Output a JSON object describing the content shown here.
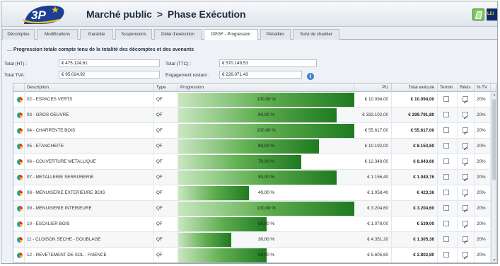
{
  "header": {
    "logo_text": "3P",
    "crumb_root": "Marché public",
    "crumb_sep": ">",
    "crumb_page": "Phase Exécution",
    "user_badge": "LEI"
  },
  "tabs": [
    {
      "label": "Décomptes",
      "active": false
    },
    {
      "label": "Modifications",
      "active": false
    },
    {
      "label": "Garantie",
      "active": false
    },
    {
      "label": "Suspensions",
      "active": false
    },
    {
      "label": "Délai d'exécution",
      "active": false
    },
    {
      "label": "DPGF - Progression",
      "active": true
    },
    {
      "label": "Pénalités",
      "active": false
    },
    {
      "label": "Suivi de chantier",
      "active": false
    }
  ],
  "summary": {
    "title": "Progression totale compte tenu de la totalité des décomptes et des avenants",
    "total_ht_label": "Total (HT) :",
    "total_ht_value": "€ 475.124,61",
    "total_ttc_label": "Total (TTC) :",
    "total_ttc_value": "€ 570.149,53",
    "total_tva_label": "Total TVA :",
    "total_tva_value": "€ 95.024,92",
    "engagement_label": "Engagement restant :",
    "engagement_value": "€ 226.071,43",
    "info_glyph": "i"
  },
  "grid": {
    "columns": {
      "description": "Description",
      "type": "Type",
      "progression": "Progression",
      "pu": "PU",
      "total": "Total exécuté",
      "termin": "Termin",
      "revis": "Révis",
      "tva": "% TV"
    },
    "rows": [
      {
        "description": "02 - ESPACES VERTS",
        "type": "QF",
        "progress": 100,
        "progress_label": "100,00 %",
        "pu": "€ 10.094,00",
        "total": "€ 10.094,00",
        "termine": false,
        "revis": true,
        "tva": "20%"
      },
      {
        "description": "03 - GROS OEUVRE",
        "type": "QF",
        "progress": 90,
        "progress_label": "90,00 %",
        "pu": "€ 333.102,00",
        "total": "€ 299.791,80",
        "termine": false,
        "revis": true,
        "tva": "20%"
      },
      {
        "description": "04 - CHARPENTE BOIS",
        "type": "QF",
        "progress": 100,
        "progress_label": "100,00 %",
        "pu": "€ 55.617,00",
        "total": "€ 55.617,00",
        "termine": false,
        "revis": true,
        "tva": "20%"
      },
      {
        "description": "05 - ETANCHEITE",
        "type": "QF",
        "progress": 80,
        "progress_label": "80,00 %",
        "pu": "€ 10.192,00",
        "total": "€ 8.153,60",
        "termine": false,
        "revis": true,
        "tva": "20%"
      },
      {
        "description": "06 - COUVERTURE METALLIQUE",
        "type": "QF",
        "progress": 70,
        "progress_label": "70,00 %",
        "pu": "€ 12.348,00",
        "total": "€ 8.643,60",
        "termine": false,
        "revis": true,
        "tva": "20%"
      },
      {
        "description": "07 - METALLERIE SERRURERIE",
        "type": "QF",
        "progress": 90,
        "progress_label": "90,00 %",
        "pu": "€ 1.156,40",
        "total": "€ 1.040,76",
        "termine": false,
        "revis": true,
        "tva": "20%"
      },
      {
        "description": "08 - MENUISERIE EXTERIEURE BOIS",
        "type": "QF",
        "progress": 40,
        "progress_label": "40,00 %",
        "pu": "€ 1.058,40",
        "total": "€ 423,36",
        "termine": false,
        "revis": true,
        "tva": "20%"
      },
      {
        "description": "09 - MENUISERIE INTERIEURE",
        "type": "QF",
        "progress": 100,
        "progress_label": "100,00 %",
        "pu": "€ 3.204,60",
        "total": "€ 3.204,60",
        "termine": false,
        "revis": true,
        "tva": "20%"
      },
      {
        "description": "10 - ESCALIER BOIS",
        "type": "QF",
        "progress": 50,
        "progress_label": "50,00 %",
        "pu": "€ 1.078,00",
        "total": "€ 539,00",
        "termine": false,
        "revis": true,
        "tva": "20%"
      },
      {
        "description": "11 - CLOISON SECHE - DOUBLAGE",
        "type": "QF",
        "progress": 30,
        "progress_label": "30,00 %",
        "pu": "€ 4.351,20",
        "total": "€ 1.305,36",
        "termine": false,
        "revis": true,
        "tva": "20%"
      },
      {
        "description": "12 - REVETEMENT DE SOL - FAIENCE",
        "type": "QF",
        "progress": 50,
        "progress_label": "50,00 %",
        "pu": "€ 5.605,60",
        "total": "€ 2.802,80",
        "termine": false,
        "revis": true,
        "tva": "20%"
      }
    ]
  }
}
